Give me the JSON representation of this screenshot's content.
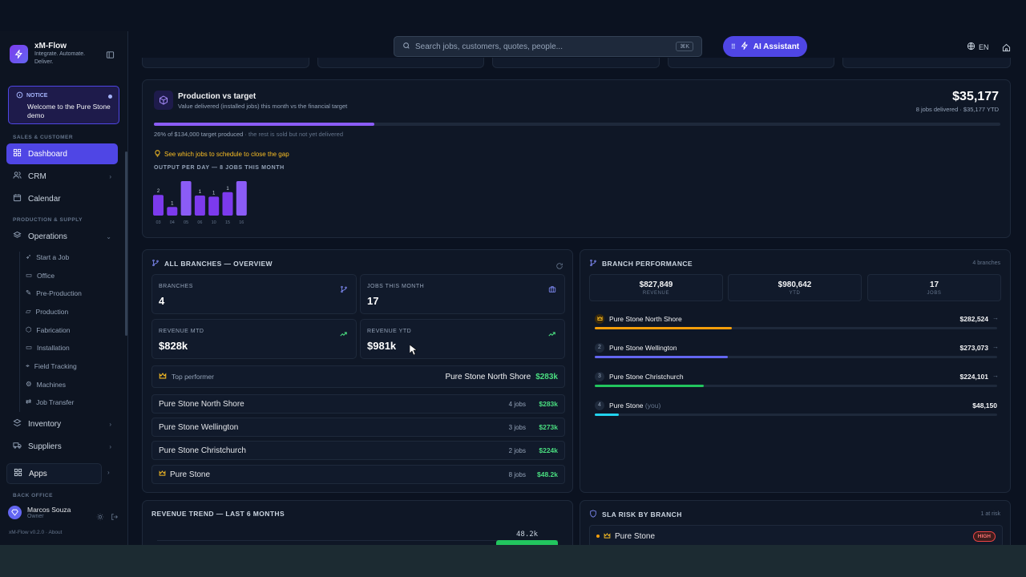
{
  "app": {
    "name": "xM-Flow",
    "tagline": "Integrate. Automate. Deliver.",
    "version": "xM-Flow v0.2.0 · About"
  },
  "notice": {
    "tag": "NOTICE",
    "text": "Welcome to the Pure Stone demo"
  },
  "sidebar": {
    "sections": {
      "sales": "SALES & CUSTOMER",
      "production": "PRODUCTION & SUPPLY",
      "back": "BACK OFFICE"
    },
    "items": {
      "dashboard": "Dashboard",
      "crm": "CRM",
      "calendar": "Calendar",
      "operations": "Operations",
      "inventory": "Inventory",
      "suppliers": "Suppliers",
      "apps": "Apps"
    },
    "sub": [
      "Start a Job",
      "Office",
      "Pre-Production",
      "Production",
      "Fabrication",
      "Installation",
      "Field Tracking",
      "Machines",
      "Job Transfer"
    ]
  },
  "user": {
    "name": "Marcos Souza",
    "role": "Owner"
  },
  "topbar": {
    "search_placeholder": "Search jobs, customers, quotes, people...",
    "shortcut": "⌘K",
    "ai_label": "AI Assistant",
    "lang": "EN"
  },
  "production": {
    "title": "Production vs target",
    "subtitle": "Value delivered (installed jobs) this month vs the financial target",
    "amount": "$35,177",
    "meta": "8 jobs delivered · $35,177 YTD",
    "progress": 0.26,
    "note_main": "26% of $134,000 target produced",
    "note_rest": " · the rest is sold but not yet delivered",
    "link": "See which jobs to schedule to close the gap",
    "chart_title": "OUTPUT PER DAY — 8 JOBS THIS MONTH"
  },
  "chart_data": {
    "type": "bar",
    "categories": [
      "03",
      "04",
      "05",
      "06",
      "10",
      "15",
      "16"
    ],
    "values": [
      2,
      1,
      3,
      1,
      1,
      1,
      3
    ],
    "labels": [
      "2",
      "1",
      "",
      "1",
      "1",
      "1",
      ""
    ],
    "heights": [
      0.6,
      0.25,
      1.0,
      0.58,
      0.55,
      0.68,
      1.0
    ]
  },
  "branches": {
    "title": "ALL BRANCHES — OVERVIEW",
    "stats": [
      {
        "label": "BRANCHES",
        "value": "4"
      },
      {
        "label": "JOBS THIS MONTH",
        "value": "17"
      },
      {
        "label": "REVENUE MTD",
        "value": "$828k"
      },
      {
        "label": "REVENUE YTD",
        "value": "$981k"
      }
    ],
    "top_label": "Top performer",
    "top_name": "Pure Stone North Shore",
    "top_value": "$283k",
    "rows": [
      {
        "name": "Pure Stone North Shore",
        "jobs": "4 jobs",
        "rev": "$283k"
      },
      {
        "name": "Pure Stone Wellington",
        "jobs": "3 jobs",
        "rev": "$273k"
      },
      {
        "name": "Pure Stone Christchurch",
        "jobs": "2 jobs",
        "rev": "$224k"
      },
      {
        "name": "Pure Stone",
        "jobs": "8 jobs",
        "rev": "$48.2k"
      }
    ]
  },
  "branch_perf": {
    "title": "BRANCH PERFORMANCE",
    "count": "4 branches",
    "stats": [
      {
        "value": "$827,849",
        "label": "REVENUE"
      },
      {
        "value": "$980,642",
        "label": "YTD"
      },
      {
        "value": "17",
        "label": "JOBS"
      }
    ],
    "rows": [
      {
        "rank": "",
        "name": "Pure Stone North Shore",
        "suffix": "",
        "value": "$282,524",
        "share": 0.34,
        "color": "#f59e0b"
      },
      {
        "rank": "2",
        "name": "Pure Stone Wellington",
        "suffix": "",
        "value": "$273,073",
        "share": 0.33,
        "color": "#6366f1"
      },
      {
        "rank": "3",
        "name": "Pure Stone Christchurch",
        "suffix": "",
        "value": "$224,101",
        "share": 0.27,
        "color": "#22c55e"
      },
      {
        "rank": "4",
        "name": "Pure Stone",
        "suffix": "(you)",
        "value": "$48,150",
        "share": 0.06,
        "color": "#22d3ee"
      }
    ]
  },
  "revenue_trend": {
    "title": "REVENUE TREND — LAST 6 MONTHS",
    "last_value": "48.2k"
  },
  "sla": {
    "title": "SLA RISK BY BRANCH",
    "count": "1 at risk",
    "row_name": "Pure Stone",
    "badge": "HIGH"
  }
}
